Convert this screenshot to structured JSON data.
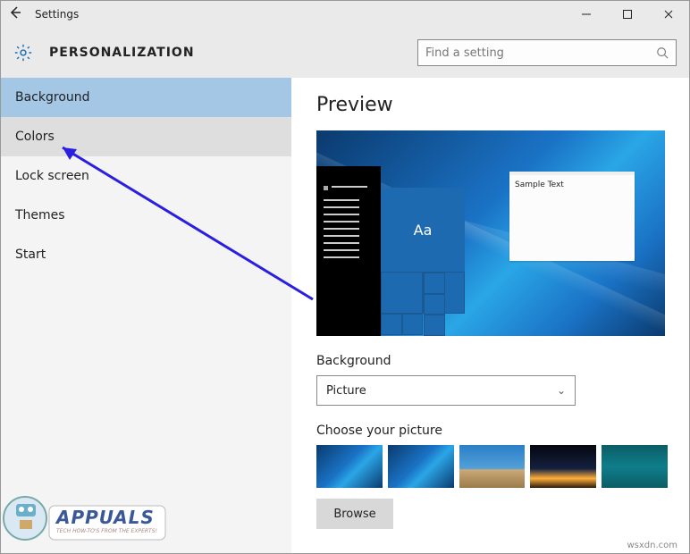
{
  "window": {
    "title": "Settings"
  },
  "header": {
    "title": "PERSONALIZATION",
    "search_placeholder": "Find a setting"
  },
  "sidebar": {
    "items": [
      {
        "label": "Background",
        "state": "selected"
      },
      {
        "label": "Colors",
        "state": "hover"
      },
      {
        "label": "Lock screen",
        "state": ""
      },
      {
        "label": "Themes",
        "state": ""
      },
      {
        "label": "Start",
        "state": ""
      }
    ]
  },
  "main": {
    "preview_heading": "Preview",
    "preview_sample_text": "Sample Text",
    "preview_aa": "Aa",
    "background_label": "Background",
    "background_value": "Picture",
    "choose_label": "Choose your picture",
    "browse_label": "Browse"
  },
  "watermark": {
    "brand": "APPUALS",
    "tagline": "TECH HOW-TO'S FROM THE EXPERTS!",
    "site": "wsxdn.com"
  }
}
